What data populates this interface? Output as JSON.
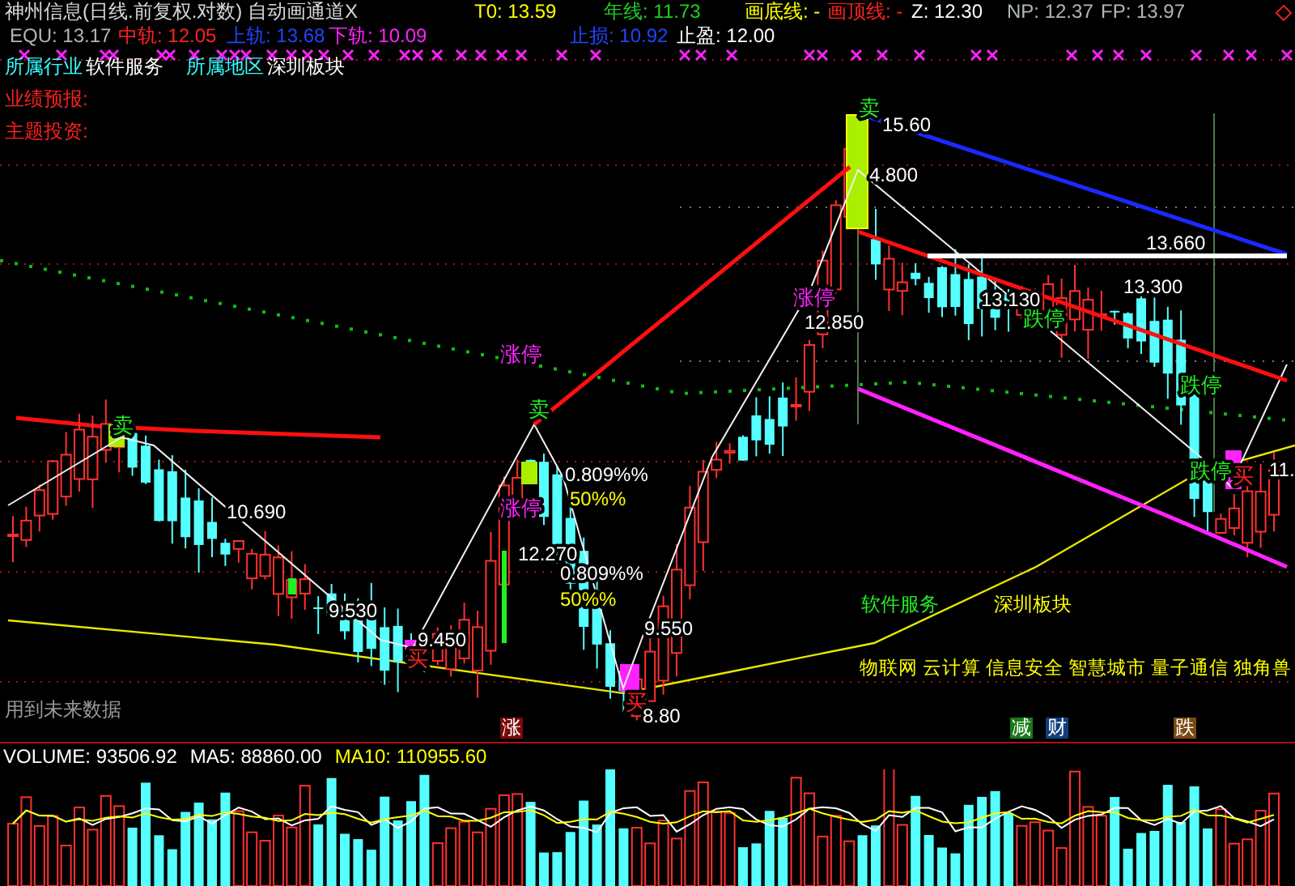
{
  "title": "神州信息(日线.前复权.对数) 自动画通道X",
  "row1": [
    {
      "text": "T0: 13.59",
      "color": "#ffff00"
    },
    {
      "text": "年线: 11.73",
      "color": "#22cc22"
    },
    {
      "text": "画底线: -",
      "color": "#ffff00"
    },
    {
      "text": "画顶线: -",
      "color": "#ff2222"
    },
    {
      "text": "Z: 12.30",
      "color": "#ffffff"
    },
    {
      "text": "NP: 12.37",
      "color": "#b0b8b0"
    },
    {
      "text": "FP: 13.97",
      "color": "#b0b8b0"
    }
  ],
  "row2": [
    {
      "text": "EQU: 13.17",
      "color": "#b0b8b0"
    },
    {
      "text": "中轨: 12.05",
      "color": "#ff2222"
    },
    {
      "text": "上轨: 13.68",
      "color": "#2244ff"
    },
    {
      "text": "下轨: 10.09",
      "color": "#ff22ff"
    },
    {
      "text": "止损: 10.92",
      "color": "#2244ff"
    },
    {
      "text": "止盈: 12.00",
      "color": "#ffffff"
    }
  ],
  "info": [
    {
      "label": "所属行业",
      "value": "软件服务"
    },
    {
      "label": "所属地区",
      "value": "深圳板块"
    }
  ],
  "notes": [
    "业绩预报:",
    "主题投资:"
  ],
  "labels": [
    {
      "text": "卖",
      "kind": "sell"
    },
    {
      "text": "卖",
      "kind": "sell"
    },
    {
      "text": "卖",
      "kind": "sell"
    },
    {
      "text": "涨停",
      "kind": "limit_up"
    },
    {
      "text": "涨停",
      "kind": "limit_up"
    },
    {
      "text": "涨停",
      "kind": "limit_up"
    },
    {
      "text": "跌停",
      "kind": "limit_down"
    },
    {
      "text": "跌停",
      "kind": "limit_down"
    },
    {
      "text": "跌停",
      "kind": "limit_down"
    },
    {
      "text": "买",
      "kind": "buy"
    },
    {
      "text": "买",
      "kind": "buy"
    },
    {
      "text": "买",
      "kind": "buy"
    },
    {
      "text": "15.60",
      "kind": "price"
    },
    {
      "text": "4.800",
      "kind": "price"
    },
    {
      "text": "12.850",
      "kind": "price"
    },
    {
      "text": "13.130",
      "kind": "price"
    },
    {
      "text": "13.300",
      "kind": "price"
    },
    {
      "text": "13.660",
      "kind": "price"
    },
    {
      "text": "10.690",
      "kind": "price"
    },
    {
      "text": "9.530",
      "kind": "price"
    },
    {
      "text": "9.450",
      "kind": "price"
    },
    {
      "text": "12.270",
      "kind": "price"
    },
    {
      "text": "0.809%%",
      "kind": "fib"
    },
    {
      "text": "50%%",
      "kind": "fib_half"
    },
    {
      "text": "0.809%%",
      "kind": "fib"
    },
    {
      "text": "50%%",
      "kind": "fib_half"
    },
    {
      "text": "9.550",
      "kind": "price"
    },
    {
      "text": "8.80",
      "kind": "price"
    },
    {
      "text": "11.",
      "kind": "price"
    }
  ],
  "future_data_note": "用到未来数据",
  "sector_tags": [
    {
      "text": "软件服务",
      "color": "#22ee22"
    },
    {
      "text": "深圳板块",
      "color": "#ffff00"
    }
  ],
  "concepts": [
    "物联网",
    "云计算",
    "信息安全",
    "智慧城市",
    "量子通信",
    "独角兽"
  ],
  "badges": [
    {
      "text": "涨",
      "color": "#7a0a0a"
    },
    {
      "text": "减",
      "color": "#1a7a1a"
    },
    {
      "text": "财",
      "color": "#10407a"
    },
    {
      "text": "跌",
      "color": "#7a4a10"
    }
  ],
  "volume": [
    {
      "text": "VOLUME: 93506.92",
      "color": "#ffffff"
    },
    {
      "text": "MA5: 88860.00",
      "color": "#ffffff"
    },
    {
      "text": "MA10: 110955.60",
      "color": "#ffff00"
    }
  ]
}
